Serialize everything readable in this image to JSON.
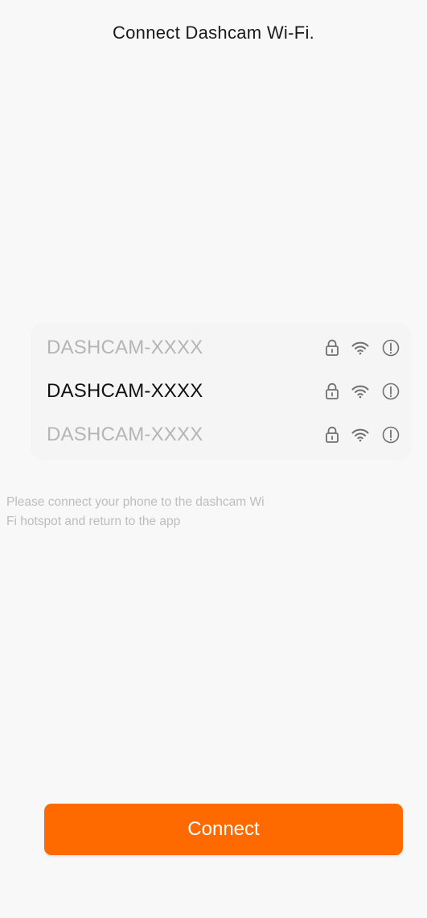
{
  "screen": {
    "title": "Connect Dashcam Wi-Fi."
  },
  "wifi_list": {
    "items": [
      {
        "ssid": "DASHCAM-XXXX",
        "state": "inactive",
        "icons": [
          "lock-icon",
          "wifi-icon",
          "info-icon"
        ]
      },
      {
        "ssid": "DASHCAM-XXXX",
        "state": "active",
        "icons": [
          "lock-icon",
          "wifi-icon",
          "info-icon"
        ]
      },
      {
        "ssid": "DASHCAM-XXXX",
        "state": "inactive",
        "icons": [
          "lock-icon",
          "wifi-icon",
          "info-icon"
        ]
      }
    ]
  },
  "hint": {
    "text": "Please connect your phone to the dashcam  Wi\nFi hotspot and return to the app"
  },
  "connect_button": {
    "label": "Connect"
  },
  "colors": {
    "background": "#f8f8f8",
    "accent": "#ff6a00",
    "active_text": "#111111",
    "inactive_text": "#b5b5b5",
    "hint_text": "#bdbdbd"
  }
}
